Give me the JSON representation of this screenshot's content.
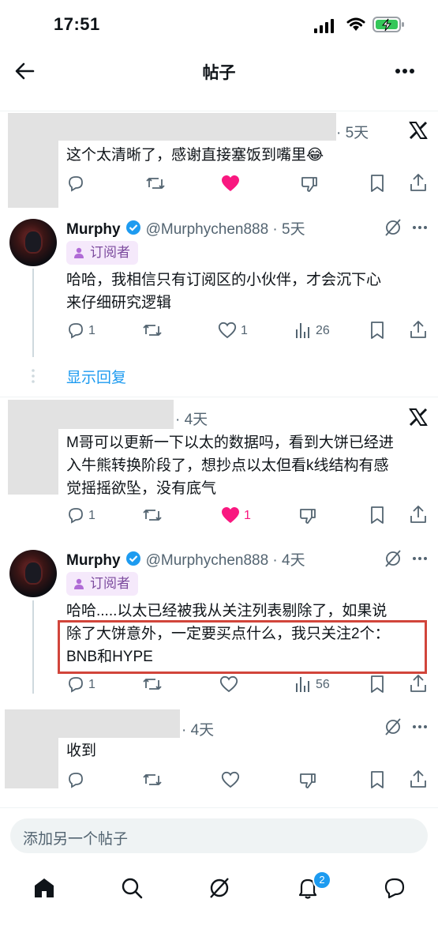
{
  "status_bar": {
    "time": "17:51"
  },
  "header": {
    "title": "帖子"
  },
  "tweets": [
    {
      "time": "· 5天",
      "text": "这个太清晰了，感谢直接塞饭到嘴里😂",
      "liked": true
    },
    {
      "name": "Murphy",
      "handle": "@Murphychen888 · 5天",
      "badge": "订阅者",
      "text_lines": [
        "哈哈，我相信只有订阅区的小伙伴，才会沉下心",
        "来仔细研究逻辑"
      ],
      "reply_count": "1",
      "like_count": "1",
      "view_count": "26"
    },
    {
      "time": "· 4天",
      "text_lines": [
        "M哥可以更新一下以太的数据吗，看到大饼已经进",
        "入牛熊转换阶段了，想抄点以太但看k线结构有感",
        "觉摇摇欲坠，没有底气"
      ],
      "reply_count": "1",
      "like_count": "1",
      "liked": true
    },
    {
      "name": "Murphy",
      "handle": "@Murphychen888 · 4天",
      "badge": "订阅者",
      "text_lines": [
        "哈哈.....以太已经被我从关注列表剔除了，如果说",
        "除了大饼意外，一定要买点什么，我只关注2个：",
        "BNB和HYPE"
      ],
      "reply_count": "1",
      "view_count": "56"
    },
    {
      "time": "· 4天",
      "text": "收到"
    }
  ],
  "show_replies": "显示回复",
  "compose": {
    "placeholder": "添加另一个帖子"
  },
  "bottom_nav": {
    "notification_count": "2",
    "items": [
      "home-icon",
      "search-icon",
      "grok-icon",
      "notifications-icon",
      "messages-icon"
    ]
  },
  "colors": {
    "accent": "#1d9bf0",
    "like": "#f91880",
    "highlight": "#d1453b",
    "badge_bg": "#f5e9fb"
  }
}
